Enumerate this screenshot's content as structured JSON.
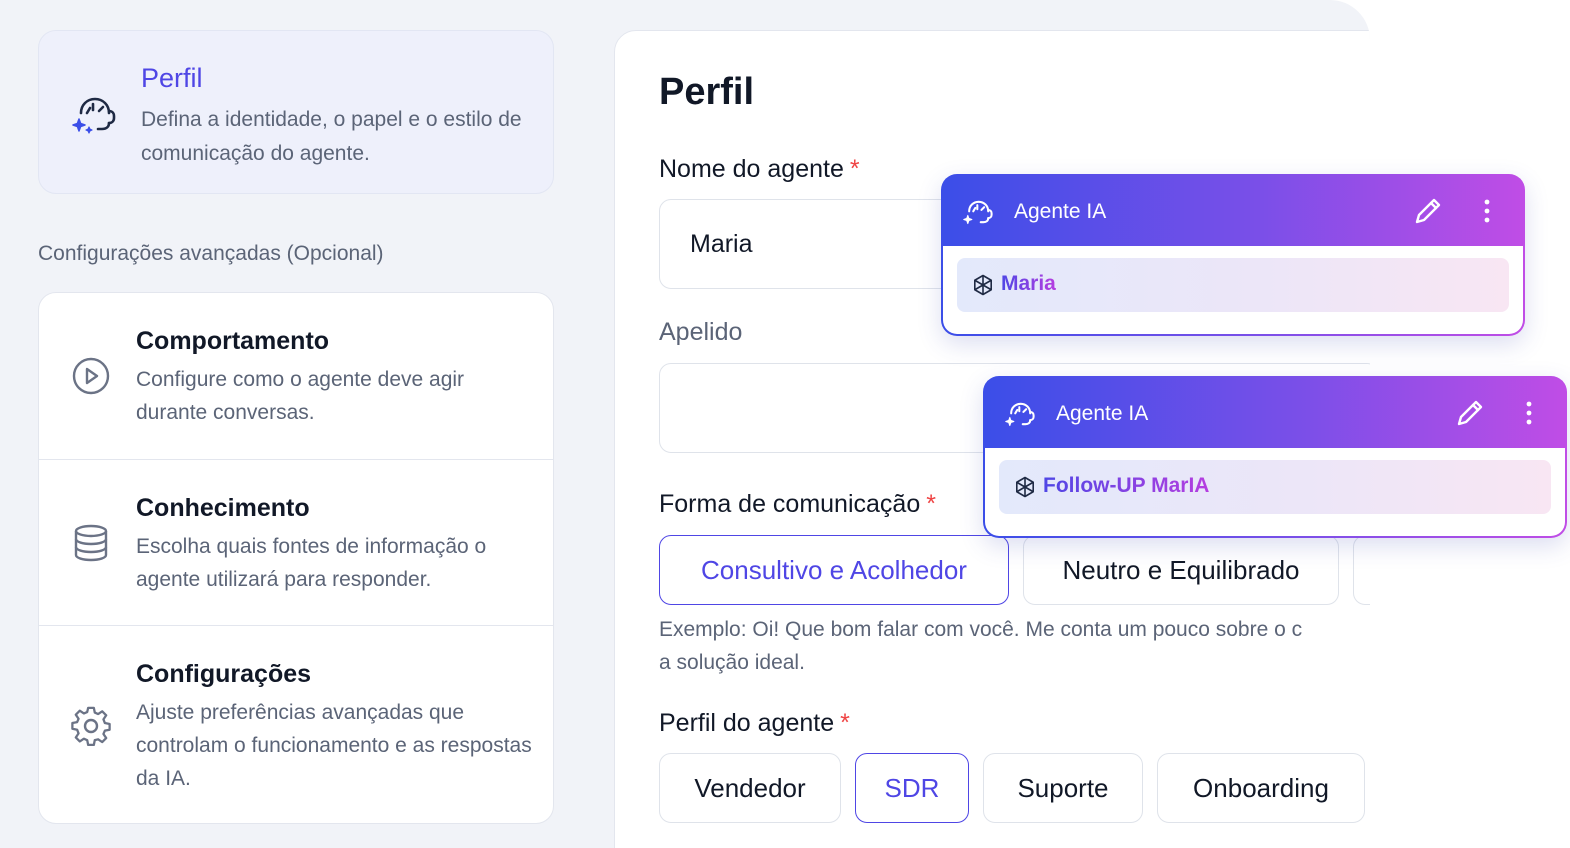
{
  "sidebar": {
    "perfil": {
      "title": "Perfil",
      "description": "Defina a identidade, o papel e o estilo de comunicação do agente.",
      "icon": "ai-headset-icon"
    },
    "advanced_label": "Configurações avançadas (Opcional)",
    "items": [
      {
        "title": "Comportamento",
        "description": "Configure como o agente deve agir durante conversas.",
        "icon": "play-circle-icon"
      },
      {
        "title": "Conhecimento",
        "description": "Escolha quais fontes de informação o agente utilizará para responder.",
        "icon": "database-icon"
      },
      {
        "title": "Configurações",
        "description": "Ajuste preferências avançadas que controlam o funcionamento e as respostas da IA.",
        "icon": "gear-icon"
      }
    ]
  },
  "form": {
    "title": "Perfil",
    "name_label": "Nome do agente",
    "name_value": "Maria",
    "nickname_label": "Apelido",
    "nickname_value": "",
    "comm_label": "Forma de comunicação",
    "comm_options": [
      "Consultivo e Acolhedor",
      "Neutro e Equilibrado"
    ],
    "comm_selected": "Consultivo e Acolhedor",
    "comm_example": "Exemplo: Oi! Que bom falar com você. Me conta um pouco sobre o c",
    "comm_example_line2": "a solução ideal.",
    "profile_label": "Perfil do agente",
    "profile_options": [
      "Vendedor",
      "SDR",
      "Suporte",
      "Onboarding"
    ],
    "profile_selected": "SDR",
    "required_mark": "*"
  },
  "agent_cards": [
    {
      "header": "Agente IA",
      "name": "Maria"
    },
    {
      "header": "Agente IA",
      "name": "Follow-UP MarIA"
    }
  ],
  "colors": {
    "accent": "#4f46e5",
    "required": "#ef4444",
    "gradient_start": "#3b4ee8",
    "gradient_end": "#c04de6",
    "background": "#f1f3f8"
  }
}
